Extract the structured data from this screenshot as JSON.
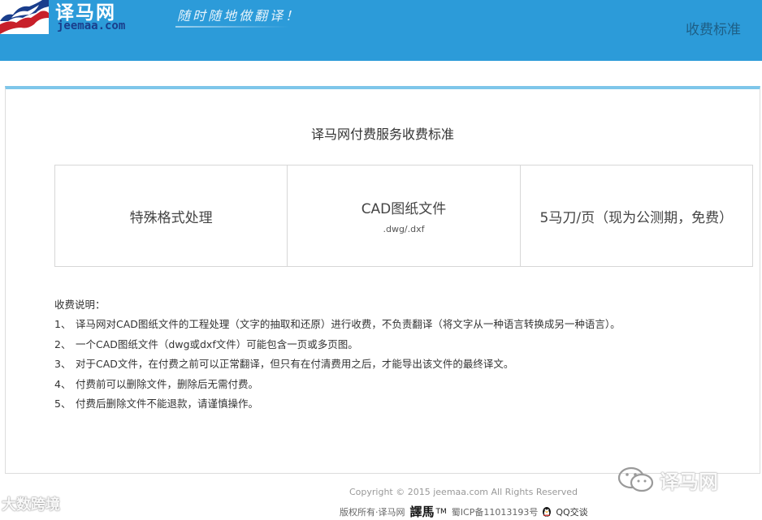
{
  "header": {
    "logo_cn": "译马网",
    "logo_en": "jeemaa.com",
    "slogan": "随时随地做翻译！",
    "nav_fee_label": "收费标准"
  },
  "main": {
    "title": "译马网付费服务收费标准",
    "table": {
      "service": "特殊格式处理",
      "file_type": "CAD图纸文件",
      "file_ext": ".dwg/.dxf",
      "price": "5马刀/页（现为公测期，免费）"
    },
    "notes_heading": "收费说明：",
    "notes": [
      {
        "num": "1、",
        "text": "译马网对CAD图纸文件的工程处理（文字的抽取和还原）进行收费，不负责翻译（将文字从一种语言转换成另一种语言）。"
      },
      {
        "num": "2、",
        "text": "一个CAD图纸文件（dwg或dxf文件）可能包含一页或多页图。"
      },
      {
        "num": "3、",
        "text": "对于CAD文件，在付费之前可以正常翻译，但只有在付清费用之后，才能导出该文件的最终译文。"
      },
      {
        "num": "4、",
        "text": "付费前可以删除文件，删除后无需付费。"
      },
      {
        "num": "5、",
        "text": "付费后删除文件不能退款，请谨慎操作。"
      }
    ]
  },
  "footer": {
    "copyright": "Copyright © 2015 jeemaa.com All Rights Reserved",
    "rights": "版权所有·译马网",
    "brand": "譯馬",
    "tm": "TM",
    "icp": "蜀ICP备11013193号",
    "qq_label": "QQ交谈"
  },
  "watermarks": {
    "left": "大数跨境",
    "right": "译马网"
  },
  "colors": {
    "header_bg": "#2c9bd9",
    "panel_top_border": "#7ec6ea",
    "logo_red": "#c8202a",
    "logo_navy": "#1a3e8c"
  },
  "icons": [
    "horse-logo-icon",
    "wechat-icon",
    "qq-penguin-icon"
  ]
}
